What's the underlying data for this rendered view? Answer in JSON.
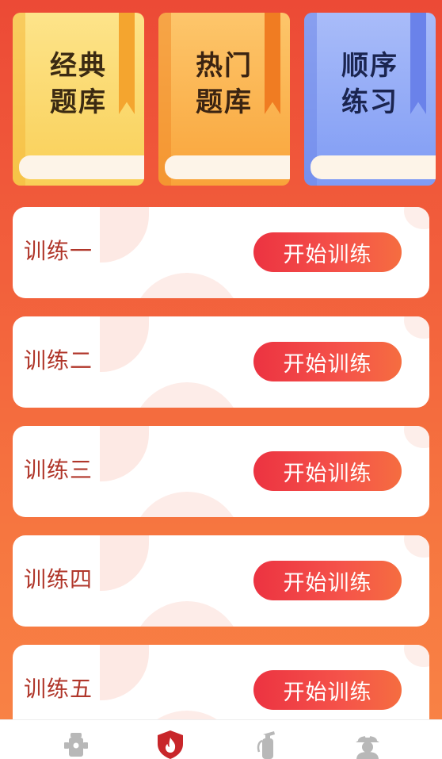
{
  "books": [
    {
      "id": "classic",
      "line1": "经典",
      "line2": "题库"
    },
    {
      "id": "hot",
      "line1": "热门",
      "line2": "题库"
    },
    {
      "id": "order",
      "line1": "顺序",
      "line2": "练习"
    }
  ],
  "trainings": [
    {
      "label": "训练一",
      "button": "开始训练"
    },
    {
      "label": "训练二",
      "button": "开始训练"
    },
    {
      "label": "训练三",
      "button": "开始训练"
    },
    {
      "label": "训练四",
      "button": "开始训练"
    },
    {
      "label": "训练五",
      "button": "开始训练"
    }
  ],
  "tabbar": {
    "items": [
      {
        "icon": "hydrant-icon",
        "active": false
      },
      {
        "icon": "flame-shield-icon",
        "active": true
      },
      {
        "icon": "extinguisher-icon",
        "active": false
      },
      {
        "icon": "firefighter-icon",
        "active": false
      }
    ],
    "active_color": "#c8262a",
    "inactive_color": "#b8b8b8"
  },
  "colors": {
    "button_gradient_start": "#ec3341",
    "button_gradient_end": "#f56d40",
    "label_color": "#b0362a"
  }
}
